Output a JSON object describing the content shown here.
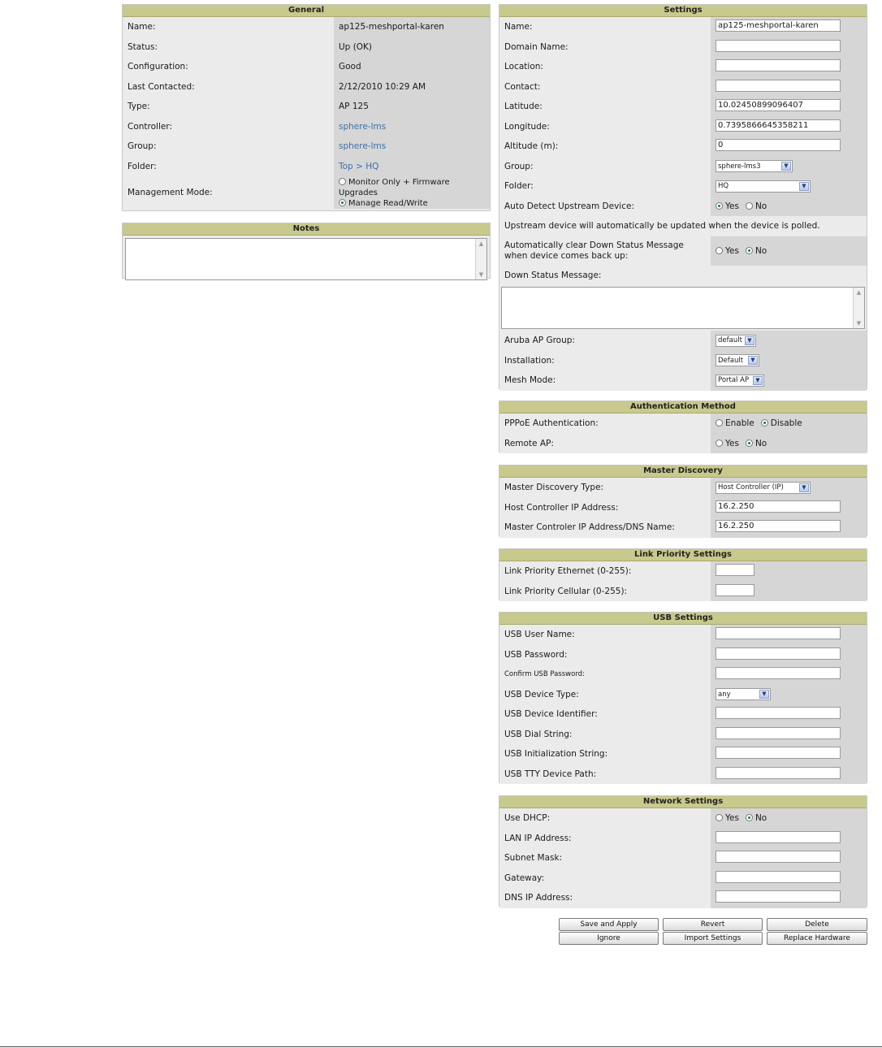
{
  "general": {
    "title": "General",
    "name_label": "Name:",
    "name_value": "ap125-meshportal-karen",
    "status_label": "Status:",
    "status_value": "Up (OK)",
    "config_label": "Configuration:",
    "config_value": "Good",
    "last_label": "Last Contacted:",
    "last_value": "2/12/2010 10:29 AM",
    "type_label": "Type:",
    "type_value": "AP 125",
    "controller_label": "Controller:",
    "controller_value": "sphere-lms",
    "group_label": "Group:",
    "group_value": "sphere-lms",
    "folder_label": "Folder:",
    "folder_value": "Top > HQ",
    "mode_label": "Management Mode:",
    "mode_opt1": "Monitor Only + Firmware Upgrades",
    "mode_opt2": "Manage Read/Write"
  },
  "notes": {
    "title": "Notes"
  },
  "settings": {
    "title": "Settings",
    "name_label": "Name:",
    "name_value": "ap125-meshportal-karen",
    "domain_label": "Domain Name:",
    "location_label": "Location:",
    "contact_label": "Contact:",
    "lat_label": "Latitude:",
    "lat_value": "10.02450899096407",
    "lon_label": "Longitude:",
    "lon_value": "0.7395866645358211",
    "alt_label": "Altitude (m):",
    "alt_value": "0",
    "group_label": "Group:",
    "group_value": "sphere-lms3",
    "folder_label": "Folder:",
    "folder_value": "HQ",
    "auto_label": "Auto Detect Upstream Device:",
    "upstream_note": "Upstream device will automatically be updated when the device is polled.",
    "autoclear_label": "Automatically clear Down Status Message when device comes back up:",
    "down_label": "Down Status Message:",
    "aruba_label": "Aruba AP Group:",
    "aruba_value": "default",
    "install_label": "Installation:",
    "install_value": "Default",
    "mesh_label": "Mesh Mode:",
    "mesh_value": "Portal AP",
    "yes": "Yes",
    "no": "No"
  },
  "auth": {
    "title": "Authentication Method",
    "pppoe_label": "PPPoE Authentication:",
    "enable": "Enable",
    "disable": "Disable",
    "remote_label": "Remote AP:",
    "yes": "Yes",
    "no": "No"
  },
  "master": {
    "title": "Master Discovery",
    "type_label": "Master Discovery Type:",
    "type_value": "Host Controller (IP)",
    "host_label": "Host Controller IP Address:",
    "host_value": "16.2.250",
    "mip_label": "Master Controler IP Address/DNS Name:",
    "mip_value": "16.2.250"
  },
  "link": {
    "title": "Link Priority Settings",
    "eth_label": "Link Priority Ethernet (0-255):",
    "cell_label": "Link Priority Cellular (0-255):"
  },
  "usb": {
    "title": "USB Settings",
    "user_label": "USB User Name:",
    "pass_label": "USB Password:",
    "confirm_label": "Confirm USB Password:",
    "type_label": "USB Device Type:",
    "type_value": "any",
    "ident_label": "USB Device Identifier:",
    "dial_label": "USB Dial String:",
    "init_label": "USB Initialization String:",
    "tty_label": "USB TTY Device Path:"
  },
  "network": {
    "title": "Network Settings",
    "dhcp_label": "Use DHCP:",
    "yes": "Yes",
    "no": "No",
    "lan_label": "LAN IP Address:",
    "subnet_label": "Subnet Mask:",
    "gw_label": "Gateway:",
    "dns_label": "DNS IP Address:"
  },
  "buttons": {
    "save": "Save and Apply",
    "revert": "Revert",
    "delete": "Delete",
    "ignore": "Ignore",
    "import": "Import Settings",
    "replace": "Replace Hardware"
  }
}
